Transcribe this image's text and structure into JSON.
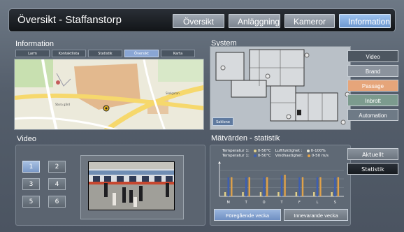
{
  "app": {
    "title": "Översikt - Staffanstorp"
  },
  "nav": [
    {
      "label": "Översikt",
      "active": false
    },
    {
      "label": "Anläggning",
      "active": false
    },
    {
      "label": "Kameror",
      "active": false
    },
    {
      "label": "Information",
      "active": true
    }
  ],
  "sections": {
    "information": "Information",
    "system": "System",
    "video": "Video",
    "stats": "Mätvärden - statistik"
  },
  "info_tabs": [
    {
      "label": "Larm",
      "active": false
    },
    {
      "label": "Kontaktlista",
      "active": false
    },
    {
      "label": "Statistik",
      "active": false
    },
    {
      "label": "Översikt",
      "active": true
    },
    {
      "label": "Karta",
      "active": false
    }
  ],
  "map": {
    "street_label": "Skolgatan",
    "place_label": "Stora gård"
  },
  "system": {
    "reset_label": "Saklone",
    "tabs": [
      {
        "label": "Video",
        "color": "#4d5660"
      },
      {
        "label": "Brand",
        "color": "#8b939d"
      },
      {
        "label": "Passage",
        "color": "#e6a57a"
      },
      {
        "label": "Inbrott",
        "color": "#7c9b8e"
      },
      {
        "label": "Automation",
        "color": "#6e7a86"
      }
    ]
  },
  "video": {
    "cameras": [
      {
        "label": "1",
        "active": true
      },
      {
        "label": "2",
        "active": false
      },
      {
        "label": "3",
        "active": false
      },
      {
        "label": "4",
        "active": false
      },
      {
        "label": "5",
        "active": false
      },
      {
        "label": "6",
        "active": false
      }
    ]
  },
  "stats": {
    "legend": [
      {
        "name": "Temperatur 1:",
        "range": "0-50°C",
        "color": "#e3d18c"
      },
      {
        "name": "Luftfuktighet :",
        "range": "0-100%",
        "color": "#e7e7d5"
      },
      {
        "name": "Temperatur 1:",
        "range": "0-50°C",
        "color": "#3e5fb2"
      },
      {
        "name": "Vindhastighet:",
        "range": "0-50 m/s",
        "color": "#e0a24a"
      }
    ],
    "tabs": [
      {
        "label": "Aktuellt",
        "active": false
      },
      {
        "label": "Statistik",
        "active": true
      }
    ],
    "prev_week": "Föregående vecka",
    "this_week": "Innevarande vecka"
  },
  "chart_data": {
    "type": "bar",
    "categories": [
      "M",
      "T",
      "O",
      "T",
      "F",
      "L",
      "S"
    ],
    "series": [
      {
        "name": "Temperatur 1",
        "values": [
          0.12,
          0.12,
          0.12,
          0.12,
          0.12,
          0.12,
          0.12
        ],
        "color": "#e3d18c"
      },
      {
        "name": "Temperatur 1",
        "values": [
          0.55,
          0.55,
          0.55,
          0.6,
          0.55,
          0.55,
          0.55
        ],
        "color": "#3e5fb2"
      },
      {
        "name": "Vindhastighet",
        "values": [
          0.55,
          0.55,
          0.55,
          0.62,
          0.55,
          0.55,
          0.55
        ],
        "color": "#e0a24a"
      }
    ],
    "ylim": [
      0,
      1
    ]
  }
}
